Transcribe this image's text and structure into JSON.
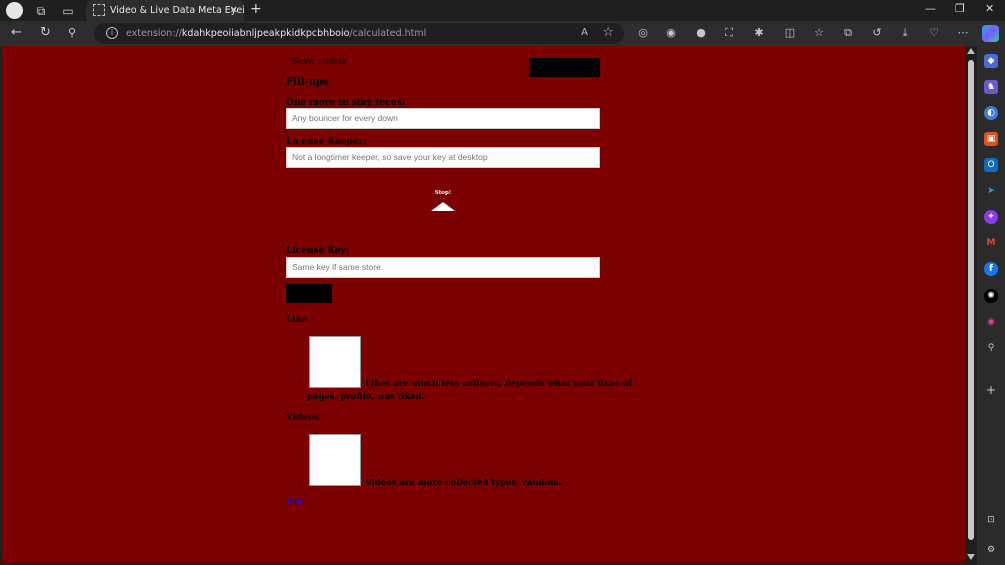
{
  "browser": {
    "tab_title": "Video & Live Data Meta Eyeing",
    "tab_close": "✕",
    "new_tab": "+",
    "url_prefix": "extension://",
    "url_host": "kdahkpeoiiabnljpeakpkidkpcbhboio",
    "url_path": "/calculated.html",
    "read_aloud": "A",
    "favorite_icon": "star-icon",
    "window_controls": [
      "—",
      "❐",
      "✕"
    ]
  },
  "page": {
    "quote": "\"Seek visible\"",
    "fillups_heading": "Fill-ups",
    "field1_label": "One more to stay focus:",
    "field1_placeholder": "Any bouncer for every down",
    "field2_label": "License Keeper:",
    "field2_placeholder": "Not a longtimer keeper, so save your key at desktop",
    "stop_label": "Stop!",
    "field3_label": "License Key:",
    "field3_placeholder": "Same key if same store.",
    "like_heading": "Like",
    "like_bullet": "◦",
    "like_desc_line1": "Likes are much less collects, depends what your likes of",
    "like_desc_line2": "pages, profile, was liked.",
    "videos_heading": "Videos",
    "videos_bullet": "◦",
    "videos_desc": "Videos are more collected types, random.",
    "link_text": "Root"
  },
  "colors": {
    "page_bg": "#7b0000",
    "button_bg": "#000000",
    "link": "#2200cc"
  }
}
